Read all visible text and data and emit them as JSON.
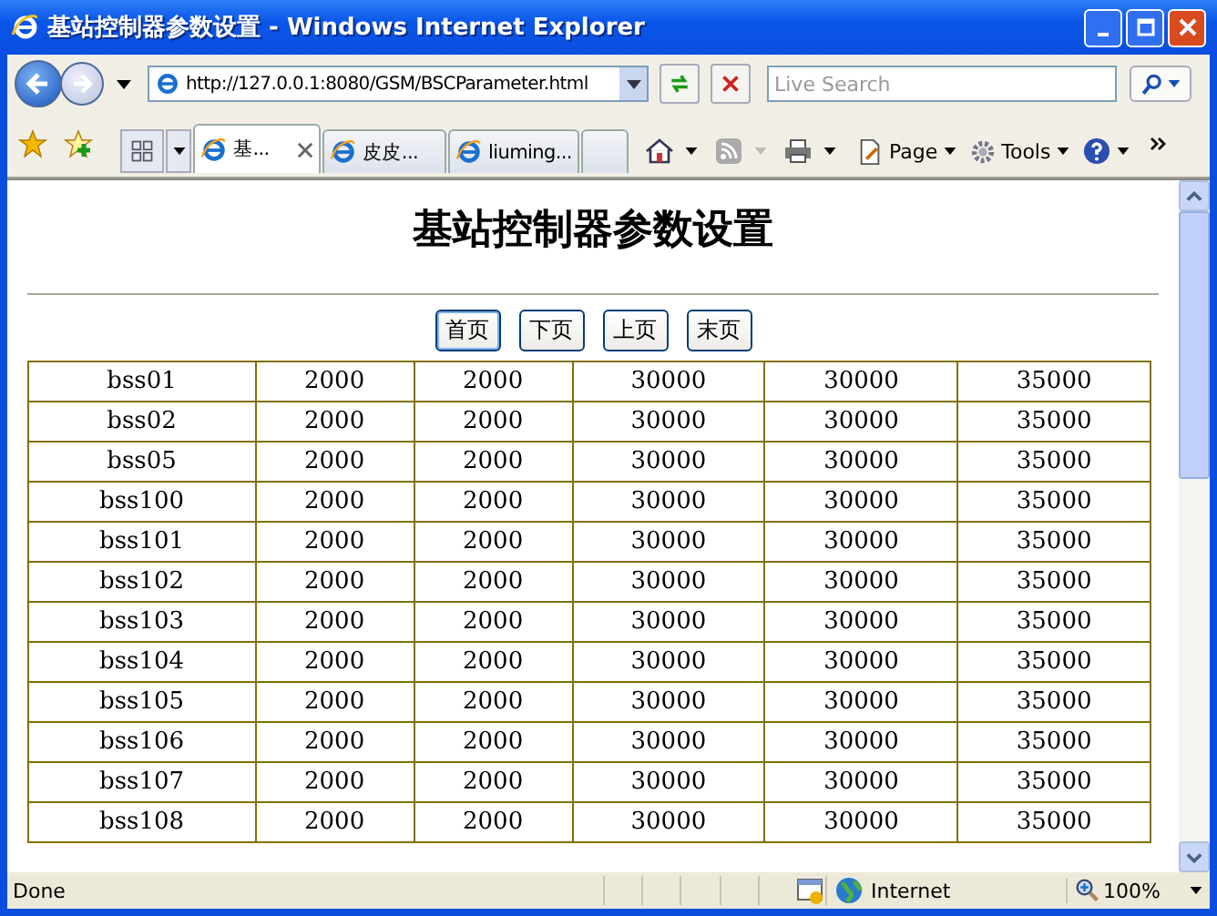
{
  "window": {
    "title": "基站控制器参数设置 - Windows Internet Explorer"
  },
  "address_bar": {
    "url": "http://127.0.0.1:8080/GSM/BSCParameter.html"
  },
  "search": {
    "placeholder": "Live Search"
  },
  "tabs": [
    {
      "label": "基...",
      "selected": true
    },
    {
      "label": "皮皮...",
      "selected": false
    },
    {
      "label": "liuming...",
      "selected": false
    }
  ],
  "command_bar": [
    "Page",
    "Tools"
  ],
  "page": {
    "heading": "基站控制器参数设置",
    "pager": [
      "首页",
      "下页",
      "上页",
      "末页"
    ],
    "table": {
      "rows": [
        [
          "bss01",
          "2000",
          "2000",
          "30000",
          "30000",
          "35000"
        ],
        [
          "bss02",
          "2000",
          "2000",
          "30000",
          "30000",
          "35000"
        ],
        [
          "bss05",
          "2000",
          "2000",
          "30000",
          "30000",
          "35000"
        ],
        [
          "bss100",
          "2000",
          "2000",
          "30000",
          "30000",
          "35000"
        ],
        [
          "bss101",
          "2000",
          "2000",
          "30000",
          "30000",
          "35000"
        ],
        [
          "bss102",
          "2000",
          "2000",
          "30000",
          "30000",
          "35000"
        ],
        [
          "bss103",
          "2000",
          "2000",
          "30000",
          "30000",
          "35000"
        ],
        [
          "bss104",
          "2000",
          "2000",
          "30000",
          "30000",
          "35000"
        ],
        [
          "bss105",
          "2000",
          "2000",
          "30000",
          "30000",
          "35000"
        ],
        [
          "bss106",
          "2000",
          "2000",
          "30000",
          "30000",
          "35000"
        ],
        [
          "bss107",
          "2000",
          "2000",
          "30000",
          "30000",
          "35000"
        ],
        [
          "bss108",
          "2000",
          "2000",
          "30000",
          "30000",
          "35000"
        ]
      ]
    }
  },
  "status_bar": {
    "status": "Done",
    "zone": "Internet",
    "zoom": "100%"
  }
}
